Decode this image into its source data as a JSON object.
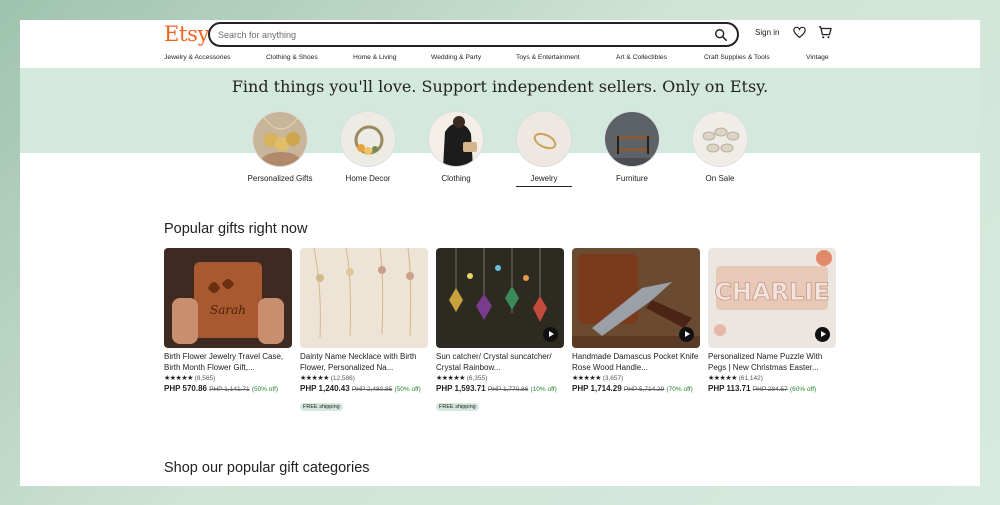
{
  "header": {
    "logo": "Etsy",
    "search_placeholder": "Search for anything",
    "signin": "Sign in"
  },
  "nav": [
    "Jewelry & Accessories",
    "Clothing & Shoes",
    "Home & Living",
    "Wedding & Party",
    "Toys & Entertainment",
    "Art & Collectibles",
    "Craft Supplies & Tools",
    "Vintage"
  ],
  "hero": {
    "title": "Find things you'll love. Support independent sellers. Only on Etsy."
  },
  "categories": [
    {
      "label": "Personalized Gifts",
      "icon": "necklace-pendants-image"
    },
    {
      "label": "Home Decor",
      "icon": "wreath-image"
    },
    {
      "label": "Clothing",
      "icon": "clothing-image"
    },
    {
      "label": "Jewelry",
      "icon": "ring-image",
      "active": true
    },
    {
      "label": "Furniture",
      "icon": "shelf-image"
    },
    {
      "label": "On Sale",
      "icon": "dishes-image"
    }
  ],
  "popular": {
    "title": "Popular gifts right now",
    "items": [
      {
        "title": "Birth Flower Jewelry Travel Case, Birth Month Flower Gift,...",
        "stars": "★★★★★",
        "reviews": "(8,565)",
        "price": "PHP 570.86",
        "original": "PHP 1,141.71",
        "discount": "(50% off)",
        "free_shipping": ""
      },
      {
        "title": "Dainty Name Necklace with Birth Flower, Personalized Na...",
        "stars": "★★★★★",
        "reviews": "(12,586)",
        "price": "PHP 1,240.43",
        "original": "PHP 2,480.85",
        "discount": "(50% off)",
        "free_shipping": "FREE shipping"
      },
      {
        "title": "Sun catcher/ Crystal suncatcher/ Crystal Rainbow...",
        "stars": "★★★★★",
        "reviews": "(6,355)",
        "price": "PHP 1,593.71",
        "original": "PHP 1,770.86",
        "discount": "(10% off)",
        "free_shipping": "FREE shipping"
      },
      {
        "title": "Handmade Damascus Pocket Knife Rose Wood Handle...",
        "stars": "★★★★★",
        "reviews": "(3,657)",
        "price": "PHP 1,714.29",
        "original": "PHP 5,714.29",
        "discount": "(70% off)",
        "free_shipping": ""
      },
      {
        "title": "Personalized Name Puzzle With Pegs | New Christmas Easter...",
        "stars": "★★★★★",
        "reviews": "(61,142)",
        "price": "PHP 113.71",
        "original": "PHP 284.57",
        "discount": "(60% off)",
        "free_shipping": ""
      }
    ]
  },
  "categories_section": {
    "title": "Shop our popular gift categories"
  },
  "colors": {
    "brand": "#f1641e",
    "hero_band": "#d4e9dd",
    "discount": "#258635"
  }
}
